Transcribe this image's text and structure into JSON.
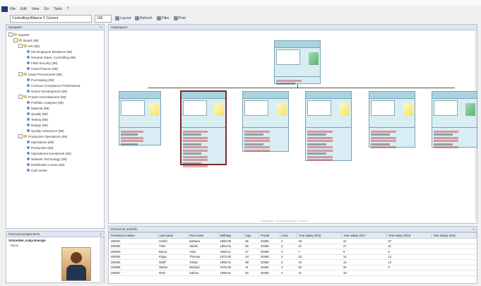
{
  "menu": [
    "File",
    "Edit",
    "View",
    "Go",
    "Tools",
    "?"
  ],
  "toolbar": {
    "org_combo": "Controlling Alliance Y Current",
    "zoom": "100",
    "btn1": "Layout",
    "btn2": "Refresh",
    "btn3": "Filter",
    "btn4": "Print"
  },
  "left": {
    "title": "Navigator",
    "tree": [
      {
        "label": "Experts",
        "kind": "folder",
        "lvl": 0
      },
      {
        "label": "Board (99)",
        "kind": "folder",
        "lvl": 1
      },
      {
        "label": "HR (99)",
        "kind": "folder",
        "lvl": 2
      },
      {
        "label": "HR Employee Relations (99)",
        "kind": "person",
        "lvl": 3
      },
      {
        "label": "General Sales, Controlling (99)",
        "kind": "person",
        "lvl": 3
      },
      {
        "label": "Field Security (99)",
        "kind": "person",
        "lvl": 3
      },
      {
        "label": "Head Finance (99)",
        "kind": "person",
        "lvl": 3
      },
      {
        "label": "Head Procurement (99)",
        "kind": "folder",
        "lvl": 2
      },
      {
        "label": "Purchasing (99)",
        "kind": "person",
        "lvl": 3
      },
      {
        "label": "Contract Compliance Professional",
        "kind": "person",
        "lvl": 3
      },
      {
        "label": "Senior Development (99)",
        "kind": "person",
        "lvl": 3
      },
      {
        "label": "Product Development (99)",
        "kind": "folder",
        "lvl": 2
      },
      {
        "label": "Portfolio Analyses (99)",
        "kind": "person",
        "lvl": 3
      },
      {
        "label": "Material (99)",
        "kind": "person",
        "lvl": 3
      },
      {
        "label": "Quality (99)",
        "kind": "person",
        "lvl": 3
      },
      {
        "label": "Testing (99)",
        "kind": "person",
        "lvl": 3
      },
      {
        "label": "Design (99)",
        "kind": "person",
        "lvl": 3
      },
      {
        "label": "Quality Assurance (99)",
        "kind": "person",
        "lvl": 3
      },
      {
        "label": "Production Operations (99)",
        "kind": "folder",
        "lvl": 2
      },
      {
        "label": "Operations (99)",
        "kind": "person",
        "lvl": 3
      },
      {
        "label": "Production (99)",
        "kind": "person",
        "lvl": 3
      },
      {
        "label": "Operational Investment (99)",
        "kind": "person",
        "lvl": 3
      },
      {
        "label": "Network Technology (99)",
        "kind": "person",
        "lvl": 3
      },
      {
        "label": "Distribution Centre (99)",
        "kind": "person",
        "lvl": 3
      },
      {
        "label": "Call Centre",
        "kind": "person",
        "lvl": 3
      }
    ]
  },
  "center": {
    "title": "Organigram",
    "watermark": "Organigram · Controlling Alliance Y Current"
  },
  "details": {
    "title": "Personal assignments",
    "person_name": "Schneider, Katja Energie",
    "field_label": "Name"
  },
  "bottom": {
    "title": "Personnel portfolio",
    "columns": [
      "Personnel number",
      "Last name",
      "First name",
      "Birthday",
      "Age",
      "Postal",
      "Area",
      "Year salary 2016",
      "Year salary 2017",
      "Year salary 2018",
      "Year salary 2019"
    ],
    "rows": [
      [
        "100001",
        "Schild",
        "Barbara",
        "1960-08",
        "56",
        "30459",
        "4",
        "48",
        "41",
        "37",
        ""
      ],
      [
        "100002",
        "Thiel",
        "Stefan",
        "1964-03",
        "52",
        "30459",
        "4",
        "31",
        "27",
        "21",
        ""
      ],
      [
        "100003",
        "Bauer",
        "Anke",
        "1969-11",
        "47",
        "30459",
        "4",
        "7",
        "9",
        "8",
        ""
      ],
      [
        "100004",
        "Kluge",
        "Thomas",
        "1972-05",
        "44",
        "30459",
        "4",
        "18",
        "14",
        "14",
        ""
      ],
      [
        "100005",
        "Wolff",
        "Tobias",
        "1958-02",
        "58",
        "30459",
        "4",
        "13",
        "10",
        "12",
        ""
      ],
      [
        "100006",
        "Weber",
        "Michael",
        "1975-09",
        "41",
        "30459",
        "4",
        "30",
        "32",
        "9",
        ""
      ],
      [
        "100007",
        "Roth",
        "Sabine",
        "1966-01",
        "50",
        "30459",
        "4",
        "21",
        "18",
        "",
        ""
      ]
    ]
  },
  "chart_colors": {
    "card_header": "#a9d3df",
    "card_body": "#d8eef4",
    "highlight": "#7a2a2a",
    "yellow": "#f4e36a",
    "green": "#5fb07a"
  }
}
